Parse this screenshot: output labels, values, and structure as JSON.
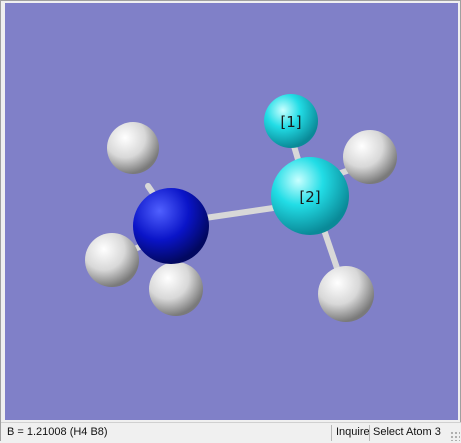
{
  "viewer": {
    "background_color": "#8080c8",
    "atoms": [
      {
        "name": "hydrogen-atom-h-top-left",
        "element": "H",
        "color": "#e8e8e8"
      },
      {
        "name": "hydrogen-atom-h-left",
        "element": "H",
        "color": "#e8e8e8"
      },
      {
        "name": "hydrogen-atom-h-bottom-left",
        "element": "H",
        "color": "#e8e8e8"
      },
      {
        "name": "nitrogen-atom",
        "element": "N",
        "color": "#1018d0"
      },
      {
        "name": "boron-atom-1",
        "element": "B",
        "color": "#20d8e0",
        "label": "[1]"
      },
      {
        "name": "boron-atom-2",
        "element": "B",
        "color": "#20d8e0",
        "label": "[2]"
      },
      {
        "name": "hydrogen-atom-h-right",
        "element": "H",
        "color": "#e8e8e8"
      },
      {
        "name": "hydrogen-atom-h-bottom-right",
        "element": "H",
        "color": "#e8e8e8"
      }
    ]
  },
  "statusbar": {
    "message": "B = 1.21008 (H4 B8)",
    "mode": "Inquire",
    "select_hint": "Select Atom 3"
  }
}
